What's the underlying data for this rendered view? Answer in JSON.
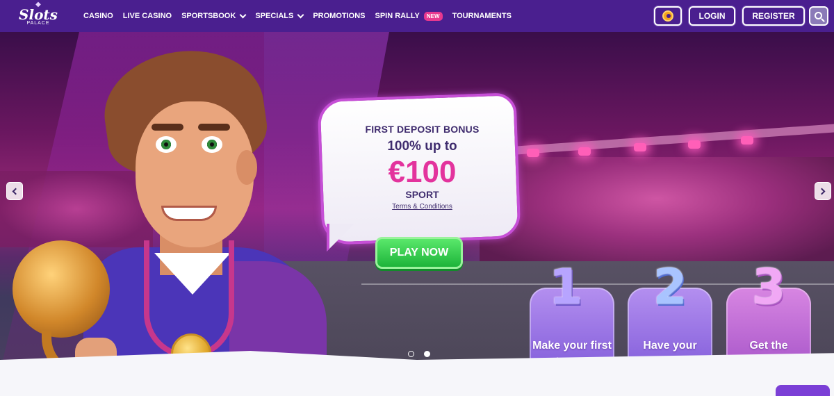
{
  "header": {
    "logo": {
      "word": "Slots",
      "sub": "PALACE"
    },
    "nav": [
      {
        "label": "CASINO",
        "dropdown": false
      },
      {
        "label": "LIVE CASINO",
        "dropdown": false
      },
      {
        "label": "SPORTSBOOK",
        "dropdown": true
      },
      {
        "label": "SPECIALS",
        "dropdown": true
      },
      {
        "label": "PROMOTIONS",
        "dropdown": false
      },
      {
        "label": "SPIN RALLY",
        "dropdown": false,
        "badge": "NEW"
      },
      {
        "label": "TOURNAMENTS",
        "dropdown": false
      }
    ],
    "login_label": "LOGIN",
    "register_label": "REGISTER",
    "icons": {
      "coin": "coin-icon",
      "search": "search-icon"
    }
  },
  "hero": {
    "bubble": {
      "line1": "FIRST DEPOSIT BONUS",
      "line2": "100% up to",
      "amount": "€100",
      "line3": "SPORT",
      "terms": "Terms & Conditions"
    },
    "cta_label": "PLAY NOW",
    "slides": {
      "total": 2,
      "active": 2
    },
    "steps": [
      {
        "number": "1",
        "label": "Make your first deposit"
      },
      {
        "number": "2",
        "label": "Have your bets settled"
      },
      {
        "number": "3",
        "label": "Get the Reward"
      }
    ]
  },
  "colors": {
    "header_bg": "#4a1f8f",
    "amount": "#e3339d",
    "cta": "#1db43a",
    "badge": "#e8388f"
  }
}
